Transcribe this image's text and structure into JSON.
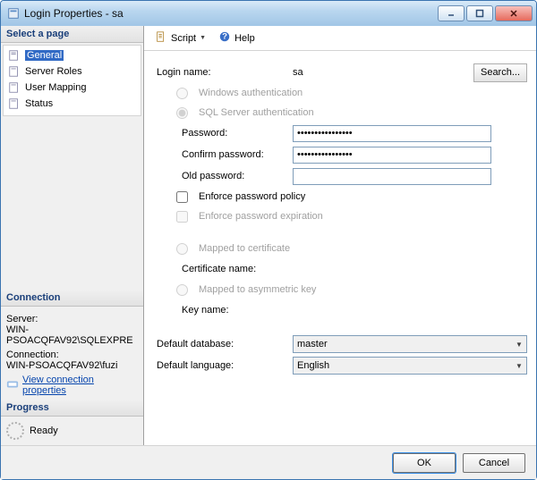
{
  "window": {
    "title": "Login Properties - sa"
  },
  "sidebar": {
    "select_page": "Select a page",
    "items": [
      {
        "label": "General"
      },
      {
        "label": "Server Roles"
      },
      {
        "label": "User Mapping"
      },
      {
        "label": "Status"
      }
    ],
    "connection_header": "Connection",
    "server_label": "Server:",
    "server_value": "WIN-PSOACQFAV92\\SQLEXPRE",
    "connection_label": "Connection:",
    "connection_value": "WIN-PSOACQFAV92\\fuzi",
    "view_conn_props": "View connection properties",
    "progress_header": "Progress",
    "progress_status": "Ready"
  },
  "toolbar": {
    "script": "Script",
    "help": "Help"
  },
  "form": {
    "login_name_label": "Login name:",
    "login_name": "sa",
    "search": "Search...",
    "windows_auth": "Windows authentication",
    "sql_auth": "SQL Server authentication",
    "password_label": "Password:",
    "password_value": "••••••••••••••••",
    "confirm_label": "Confirm password:",
    "confirm_value": "••••••••••••••••",
    "old_pw_label": "Old password:",
    "old_pw_value": "",
    "enforce_policy": "Enforce password policy",
    "enforce_expiration": "Enforce password expiration",
    "mapped_cert": "Mapped to certificate",
    "cert_name": "Certificate name:",
    "mapped_asym": "Mapped to asymmetric key",
    "key_name": "Key name:",
    "default_db_label": "Default database:",
    "default_db": "master",
    "default_lang_label": "Default language:",
    "default_lang": "English"
  },
  "footer": {
    "ok": "OK",
    "cancel": "Cancel"
  }
}
